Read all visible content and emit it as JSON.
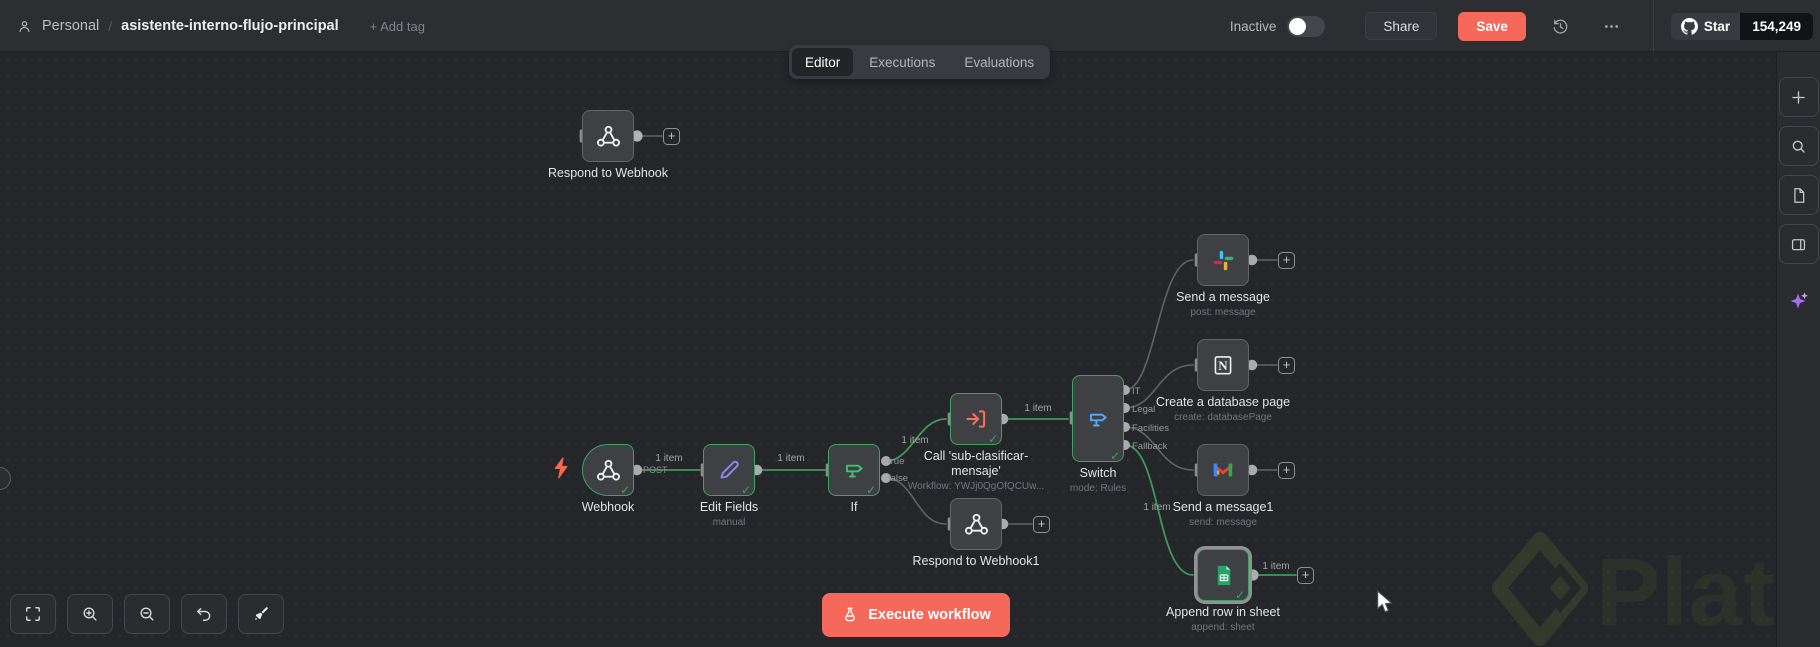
{
  "header": {
    "breadcrumb": {
      "owner": "Personal",
      "separator": "/",
      "workflow_name": "asistente-interno-flujo-principal",
      "add_tag": "+ Add tag"
    },
    "tabs": [
      {
        "label": "Editor",
        "active": true
      },
      {
        "label": "Executions",
        "active": false
      },
      {
        "label": "Evaluations",
        "active": false
      }
    ],
    "activation_label": "Inactive",
    "activation_on": false,
    "share_button": "Share",
    "save_button": "Save",
    "github_star": {
      "label": "Star",
      "count": "154,249"
    }
  },
  "canvas": {
    "execute_button": "Execute workflow",
    "nodes": [
      {
        "name": "Respond to Webhook",
        "icon": "webhook-icon",
        "status": "not-executed"
      },
      {
        "name": "Webhook",
        "icon": "webhook-icon",
        "status": "success",
        "trigger": true,
        "output_port_label": "POST"
      },
      {
        "name": "Edit Fields",
        "subtitle": "manual",
        "icon": "edit-pencil-icon",
        "status": "success"
      },
      {
        "name": "If",
        "icon": "if-branch-icon",
        "status": "success",
        "outputs": [
          "true",
          "false"
        ]
      },
      {
        "name": "Call 'sub-clasificar-mensaje'",
        "subtitle": "Workflow: YWJj0QgOfQCUw...",
        "icon": "sub-workflow-icon",
        "status": "success"
      },
      {
        "name": "Respond to Webhook1",
        "icon": "webhook-icon",
        "status": "not-executed"
      },
      {
        "name": "Switch",
        "subtitle": "mode: Rules",
        "icon": "switch-branch-icon",
        "status": "success",
        "outputs": [
          "IT",
          "Legal",
          "Facilities",
          "Fallback"
        ]
      },
      {
        "name": "Send a message",
        "subtitle": "post: message",
        "icon": "slack-icon",
        "status": "not-executed"
      },
      {
        "name": "Create a database page",
        "subtitle": "create: databasePage",
        "icon": "notion-icon",
        "status": "not-executed"
      },
      {
        "name": "Send a message1",
        "subtitle": "send: message",
        "icon": "gmail-icon",
        "status": "not-executed"
      },
      {
        "name": "Append row in sheet",
        "subtitle": "append: sheet",
        "icon": "google-sheets-icon",
        "status": "success",
        "selected": true
      }
    ],
    "edges": [
      {
        "from": "Respond to Webhook",
        "to": "add-node",
        "label": ""
      },
      {
        "from": "Webhook",
        "to": "Edit Fields",
        "label": "1 item",
        "status": "success"
      },
      {
        "from": "Edit Fields",
        "to": "If",
        "label": "1 item",
        "status": "success"
      },
      {
        "from": "If:true",
        "to": "Call 'sub-clasificar-mensaje'",
        "label": "1 item",
        "status": "success"
      },
      {
        "from": "If:false",
        "to": "Respond to Webhook1",
        "label": ""
      },
      {
        "from": "Call 'sub-clasificar-mensaje'",
        "to": "Switch",
        "label": "1 item",
        "status": "success"
      },
      {
        "from": "Switch:IT",
        "to": "Send a message",
        "label": ""
      },
      {
        "from": "Switch:Legal",
        "to": "Create a database page",
        "label": ""
      },
      {
        "from": "Switch:Facilities",
        "to": "Send a message1",
        "label": ""
      },
      {
        "from": "Switch:Fallback",
        "to": "Append row in sheet",
        "label": "1 item",
        "status": "success"
      },
      {
        "from": "Send a message",
        "to": "add-node",
        "label": ""
      },
      {
        "from": "Create a database page",
        "to": "add-node",
        "label": ""
      },
      {
        "from": "Send a message1",
        "to": "add-node",
        "label": ""
      },
      {
        "from": "Append row in sheet",
        "to": "add-node",
        "label": "1 item",
        "status": "success"
      },
      {
        "from": "Respond to Webhook1",
        "to": "add-node",
        "label": ""
      }
    ]
  },
  "canvas_controls": {
    "icons": [
      "fit-view",
      "zoom-in",
      "zoom-out",
      "undo",
      "tidy-up"
    ]
  },
  "right_rail": {
    "icons": [
      "add-node",
      "search",
      "file",
      "layout-panel",
      "ai-assistant"
    ]
  },
  "watermark": "Platzi",
  "colors": {
    "accent": "#f4695a",
    "success_green": "#3da35f",
    "canvas_bg": "#25262a",
    "header_bg": "#2d2e32",
    "node_bg": "#3f4044",
    "selected_outline": "#909296",
    "ai_purple": "#a56ef5"
  }
}
